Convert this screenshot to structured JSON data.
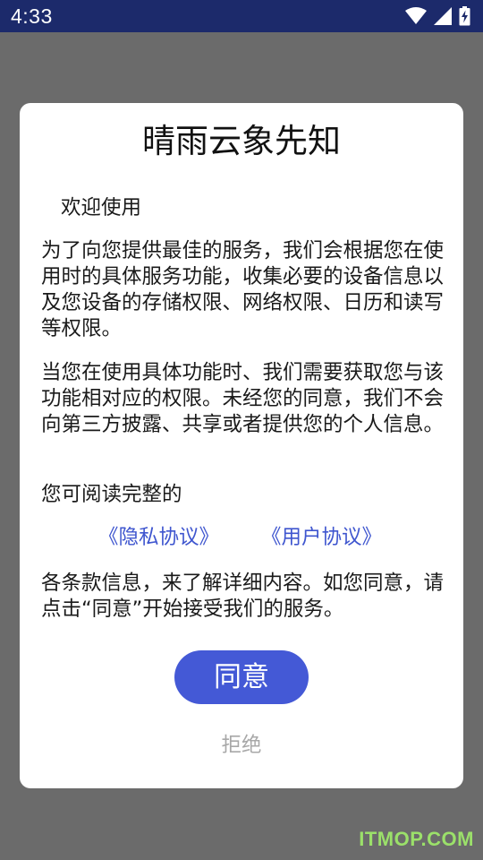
{
  "status_bar": {
    "time": "4:33",
    "icons": [
      "wifi-icon",
      "signal-icon",
      "battery-charging-icon"
    ]
  },
  "dialog": {
    "title": "晴雨云象先知",
    "welcome": "欢迎使用",
    "paragraph1": "为了向您提供最佳的服务，我们会根据您在使用时的具体服务功能，收集必要的设备信息以及您设备的存储权限、网络权限、日历和读写等权限。",
    "paragraph2": "当您在使用具体功能时、我们需要获取您与该功能相对应的权限。未经您的同意，我们不会向第三方披露、共享或者提供您的个人信息。",
    "paragraph3": "您可阅读完整的",
    "privacy_link": "《隐私协议》",
    "user_link": "《用户协议》",
    "paragraph4": "各条款信息，来了解详细内容。如您同意，请点击“同意”开始接受我们的服务。",
    "agree_label": "同意",
    "reject_label": "拒绝"
  },
  "watermark": "ITMOP.COM",
  "colors": {
    "status_bar": "#1c2a6b",
    "overlay": "#6b6b6b",
    "accent": "#4459d6",
    "link": "#3f56cf",
    "reject_text": "#a8a8a8"
  }
}
